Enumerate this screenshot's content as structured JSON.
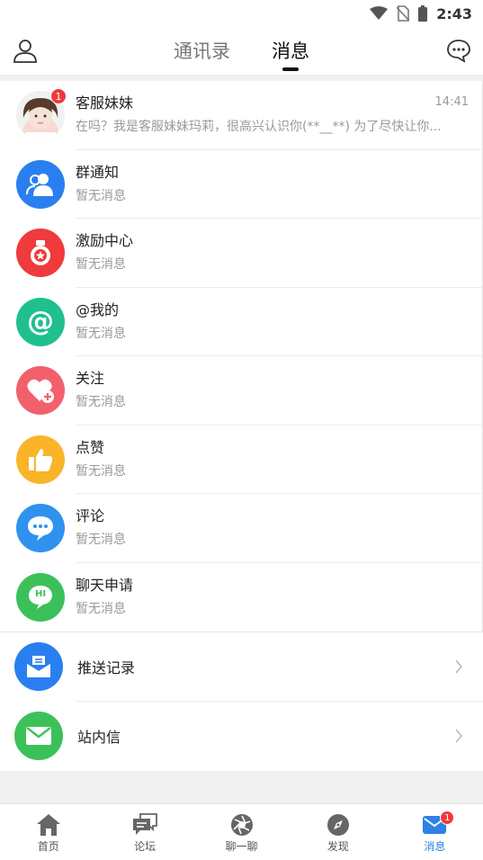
{
  "status_bar": {
    "time": "2:43"
  },
  "header": {
    "tabs": [
      {
        "label": "通讯录",
        "active": false
      },
      {
        "label": "消息",
        "active": true
      }
    ]
  },
  "messages": [
    {
      "title": "客服妹妹",
      "subtitle": "在吗？我是客服妹妹玛莉，很高兴认识你(**__**) 为了尽快让你...",
      "time": "14:41",
      "badge": "1",
      "icon": "customer-service-avatar"
    },
    {
      "title": "群通知",
      "subtitle": "暂无消息",
      "icon": "group-icon",
      "color": "#2a7ff0"
    },
    {
      "title": "激励中心",
      "subtitle": "暂无消息",
      "icon": "medal-icon",
      "color": "#ef3b3b"
    },
    {
      "title": "@我的",
      "subtitle": "暂无消息",
      "icon": "at-icon",
      "color": "#20bf8e",
      "glyph": "@"
    },
    {
      "title": "关注",
      "subtitle": "暂无消息",
      "icon": "heart-plus-icon",
      "color": "#f2606c"
    },
    {
      "title": "点赞",
      "subtitle": "暂无消息",
      "icon": "thumbs-up-icon",
      "color": "#f9b42a"
    },
    {
      "title": "评论",
      "subtitle": "暂无消息",
      "icon": "comment-icon",
      "color": "#2f92ee"
    },
    {
      "title": "聊天申请",
      "subtitle": "暂无消息",
      "icon": "chat-request-icon",
      "color": "#3cc15a",
      "glyph": "HI"
    }
  ],
  "links": [
    {
      "label": "推送记录",
      "icon": "push-record-icon",
      "color": "#2a7ff0"
    },
    {
      "label": "站内信",
      "icon": "mail-icon",
      "color": "#3cc15a"
    }
  ],
  "bottom_nav": [
    {
      "label": "首页",
      "icon": "home-icon",
      "active": false
    },
    {
      "label": "论坛",
      "icon": "forum-icon",
      "active": false
    },
    {
      "label": "聊一聊",
      "icon": "chat-aperture-icon",
      "active": false
    },
    {
      "label": "发现",
      "icon": "compass-icon",
      "active": false
    },
    {
      "label": "消息",
      "icon": "message-icon",
      "active": true,
      "badge": "1"
    }
  ],
  "colors": {
    "accent": "#2c82e6",
    "badge": "#f03a3a"
  }
}
